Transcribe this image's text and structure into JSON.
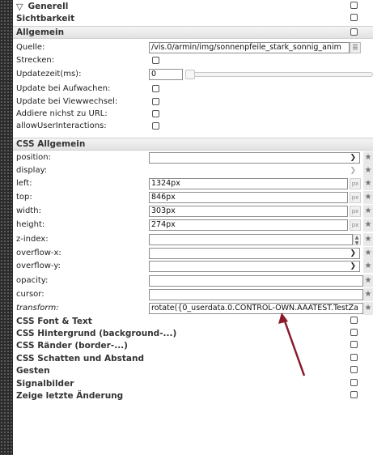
{
  "groups": {
    "generell": "Generell",
    "sichtbarkeit": "Sichtbarkeit",
    "allgemein": "Allgemein",
    "css_allgemein": "CSS Allgemein",
    "css_font": "CSS Font & Text",
    "css_hintergrund": "CSS Hintergrund (background-...)",
    "css_raender": "CSS Ränder (border-...)",
    "css_schatten": "CSS Schatten und Abstand",
    "gesten": "Gesten",
    "signalbilder": "Signalbilder",
    "letzte_aenderung": "Zeige letzte Änderung"
  },
  "allgemein": {
    "quelle_label": "Quelle:",
    "quelle_value": "/vis.0/armin/img/sonnenpfeile_stark_sonnig_anim",
    "strecken_label": "Strecken:",
    "updatezeit_label": "Updatezeit(ms):",
    "updatezeit_value": "0",
    "update_aufwachen_label": "Update bei Aufwachen:",
    "update_viewwechsel_label": "Update bei Viewwechsel:",
    "addiere_url_label": "Addiere nichst zu URL:",
    "allow_user_label": "allowUserInteractions:"
  },
  "css": {
    "position_label": "position:",
    "display_label": "display:",
    "left_label": "left:",
    "left_value": "1324px",
    "top_label": "top:",
    "top_value": "846px",
    "width_label": "width:",
    "width_value": "303px",
    "height_label": "height:",
    "height_value": "274px",
    "zindex_label": "z-index:",
    "overflowx_label": "overflow-x:",
    "overflowy_label": "overflow-y:",
    "opacity_label": "opacity:",
    "cursor_label": "cursor:",
    "transform_label": "transform:",
    "transform_value": "rotate({0_userdata.0.CONTROL-OWN.AAATEST.TestZa",
    "unit_px": "px"
  },
  "annotation": {
    "arrow_color": "#8b1a2a"
  }
}
